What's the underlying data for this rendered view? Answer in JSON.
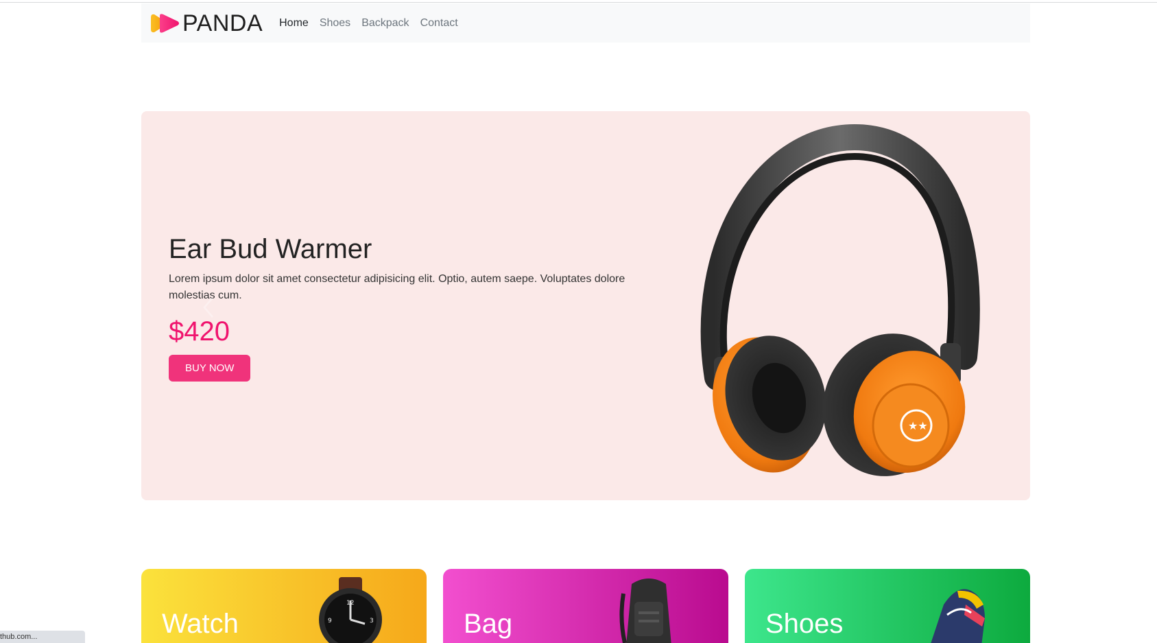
{
  "brand": {
    "name": "PANDA"
  },
  "nav": {
    "items": [
      {
        "label": "Home",
        "active": true
      },
      {
        "label": "Shoes",
        "active": false
      },
      {
        "label": "Backpack",
        "active": false
      },
      {
        "label": "Contact",
        "active": false
      }
    ]
  },
  "hero": {
    "title": "Ear Bud Warmer",
    "description": "Lorem ipsum dolor sit amet consectetur adipisicing elit. Optio, autem saepe. Voluptates dolore molestias cum.",
    "price": "$420",
    "button_label": "BUY NOW",
    "image": "headphones-image"
  },
  "categories": [
    {
      "label": "Watch",
      "image": "watch-image"
    },
    {
      "label": "Bag",
      "image": "backpack-image"
    },
    {
      "label": "Shoes",
      "image": "sneaker-image"
    }
  ],
  "status_bar": {
    "text": "thub.com..."
  },
  "colors": {
    "accent": "#f0337b",
    "price": "#f0146e",
    "hero_bg": "#fbe9e8",
    "navbar_bg": "#f8f9fa"
  }
}
